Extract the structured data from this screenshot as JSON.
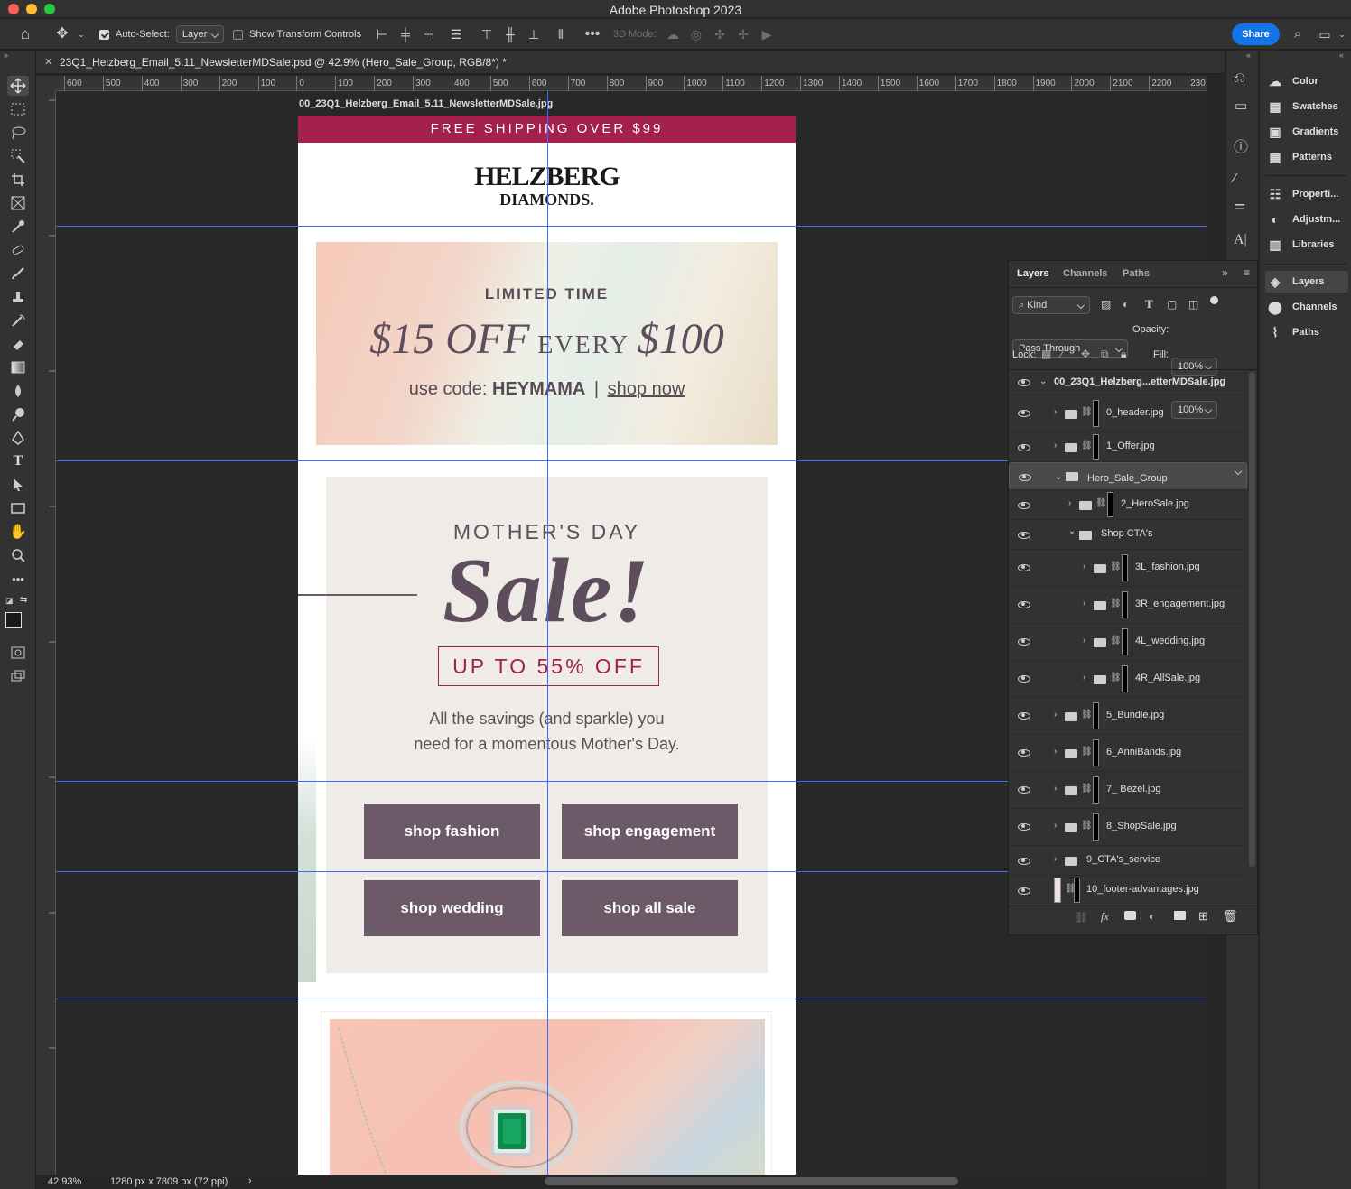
{
  "app": {
    "title": "Adobe Photoshop 2023"
  },
  "options_bar": {
    "auto_select_label": "Auto-Select:",
    "auto_select_value": "Layer",
    "show_transform_label": "Show Transform Controls",
    "mode_3d_label": "3D Mode:",
    "share_label": "Share"
  },
  "document": {
    "tab_title": "23Q1_Helzberg_Email_5.11_NewsletterMDSale.psd @ 42.9% (Hero_Sale_Group, RGB/8*) *",
    "layer_label": "00_23Q1_Helzberg_Email_5.11_NewsletterMDSale.jpg",
    "zoom": "42.93%",
    "dimensions": "1280 px x 7809 px (72 ppi)"
  },
  "ruler": {
    "top_ticks": [
      "600",
      "500",
      "400",
      "300",
      "200",
      "100",
      "0",
      "100",
      "200",
      "300",
      "400",
      "500",
      "600",
      "700",
      "800",
      "900",
      "1000",
      "1100",
      "1200",
      "1300",
      "1400",
      "1500",
      "1600",
      "1700",
      "1800",
      "1900",
      "2000",
      "2100",
      "2200",
      "230"
    ]
  },
  "email": {
    "shipping_banner": "FREE SHIPPING OVER $99",
    "logo_line1": "HELZBERG",
    "logo_line2": "DIAMONDS.",
    "offer_limited": "LIMITED TIME",
    "offer_amount": "$15 OFF",
    "offer_every": "EVERY",
    "offer_threshold": "$100",
    "offer_code_prefix": "use code:",
    "offer_code": "HEYMAMA",
    "offer_sep": "|",
    "offer_shop": "shop now",
    "hero_mothers": "MOTHER'S DAY",
    "hero_sale": "Sale!",
    "hero_discount": "UP TO 55% OFF",
    "hero_copy1": "All the savings (and sparkle) you",
    "hero_copy2": "need for a momentous Mother's Day.",
    "cta_fashion": "shop fashion",
    "cta_engagement": "shop engagement",
    "cta_wedding": "shop wedding",
    "cta_allsale": "shop all sale"
  },
  "dock": {
    "items": [
      "Color",
      "Swatches",
      "Gradients",
      "Patterns",
      "Properti...",
      "Adjustm...",
      "Libraries",
      "Layers",
      "Channels",
      "Paths"
    ]
  },
  "layers_panel": {
    "tabs": [
      "Layers",
      "Channels",
      "Paths"
    ],
    "kind_label": "Kind",
    "blend_mode": "Pass Through",
    "opacity_label": "Opacity:",
    "opacity_value": "100%",
    "lock_label": "Lock:",
    "fill_label": "Fill:",
    "fill_value": "100%",
    "layers": [
      "00_23Q1_Helzberg...etterMDSale.jpg",
      "0_header.jpg",
      "1_Offer.jpg",
      "Hero_Sale_Group",
      "2_HeroSale.jpg",
      "Shop CTA's",
      "3L_fashion.jpg",
      "3R_engagement.jpg",
      "4L_wedding.jpg",
      "4R_AllSale.jpg",
      "5_Bundle.jpg",
      "6_AnniBands.jpg",
      "7_ Bezel.jpg",
      "8_ShopSale.jpg",
      "9_CTA's_service",
      "10_footer-advantages.jpg"
    ]
  },
  "colors": {
    "accent": "#1473e6",
    "banner": "#a3204f",
    "cta": "#6c5a69",
    "sale_text": "#5e4d5c"
  }
}
